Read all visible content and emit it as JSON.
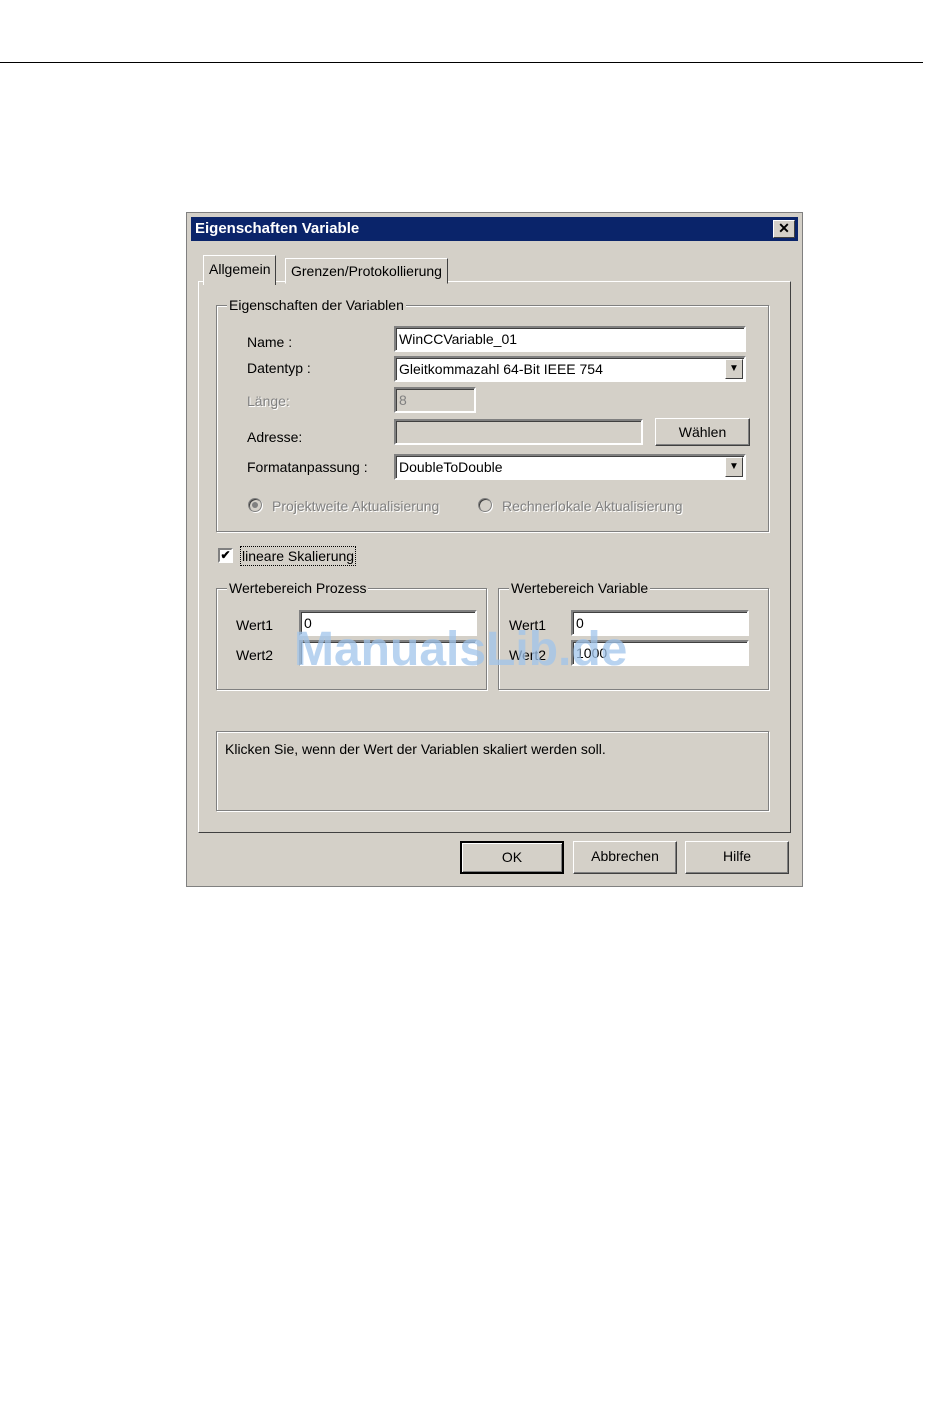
{
  "dialog": {
    "title": "Eigenschaften Variable",
    "close_glyph": "✕",
    "tabs": [
      "Allgemein",
      "Grenzen/Protokollierung"
    ],
    "group_properties": {
      "title": "Eigenschaften der Variablen",
      "name_label": "Name :",
      "name_value": "WinCCVariable_01",
      "datatype_label": "Datentyp :",
      "datatype_value": "Gleitkommazahl 64-Bit IEEE 754",
      "length_label": "Länge:",
      "length_value": "8",
      "address_label": "Adresse:",
      "address_value": "",
      "select_button": "Wählen",
      "format_label": "Formatanpassung :",
      "format_value": "DoubleToDouble",
      "radio_project": "Projektweite Aktualisierung",
      "radio_local": "Rechnerlokale Aktualisierung"
    },
    "linear_scaling": {
      "label": "lineare Skalierung",
      "checked": true,
      "check_glyph": "✔"
    },
    "process_range": {
      "title": "Wertebereich Prozess",
      "wert1_label": "Wert1",
      "wert1_value": "0",
      "wert2_label": "Wert2",
      "wert2_value": ""
    },
    "variable_range": {
      "title": "Wertebereich Variable",
      "wert1_label": "Wert1",
      "wert1_value": "0",
      "wert2_label": "Wert2",
      "wert2_value": "1000"
    },
    "hint_text": "Klicken Sie, wenn der Wert der Variablen skaliert werden soll.",
    "buttons": {
      "ok": "OK",
      "cancel": "Abbrechen",
      "help": "Hilfe"
    },
    "combo_arrow_glyph": "▼"
  },
  "watermark": "ManualsLib.de"
}
